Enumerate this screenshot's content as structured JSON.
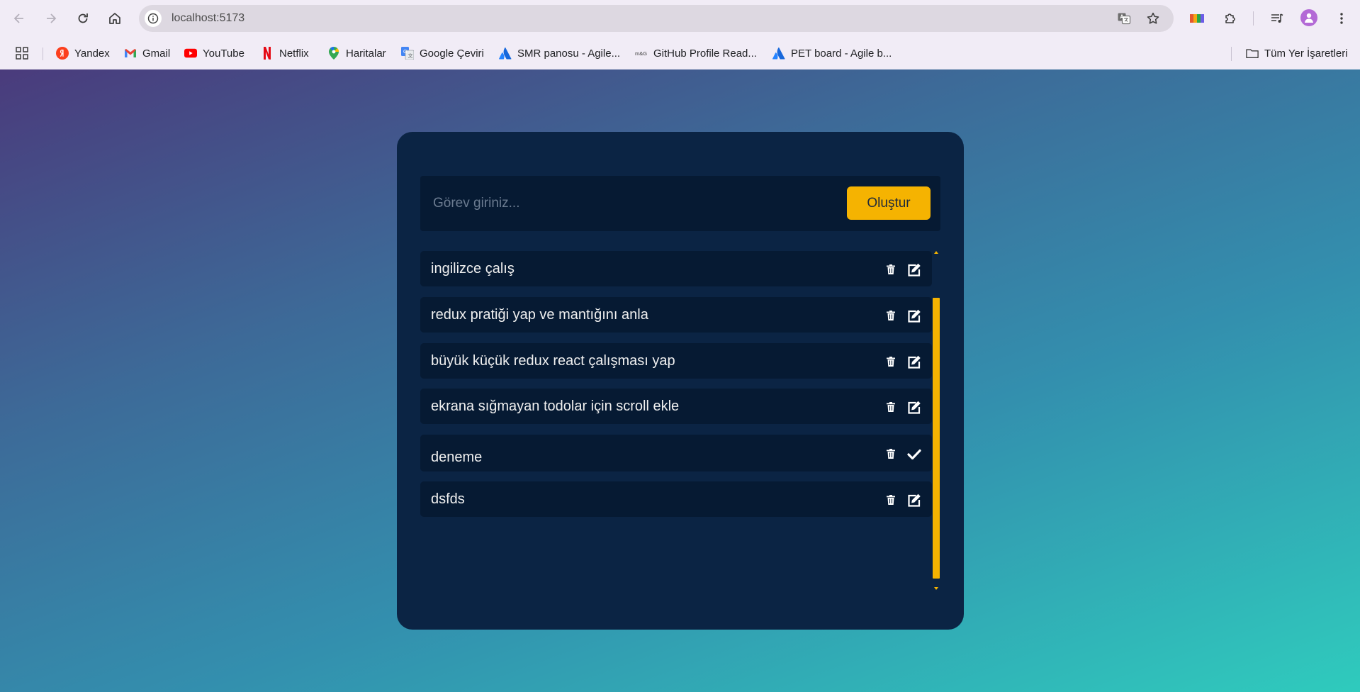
{
  "browser": {
    "url": "localhost:5173",
    "bookmarks": [
      {
        "label": "Yandex",
        "icon": "yandex-icon"
      },
      {
        "label": "Gmail",
        "icon": "gmail-icon"
      },
      {
        "label": "YouTube",
        "icon": "youtube-icon"
      },
      {
        "label": "Netflix",
        "icon": "netflix-icon"
      },
      {
        "label": "Haritalar",
        "icon": "maps-icon"
      },
      {
        "label": "Google Çeviri",
        "icon": "translate-icon"
      },
      {
        "label": "SMR panosu - Agile...",
        "icon": "atlassian-icon"
      },
      {
        "label": "GitHub Profile Read...",
        "icon": "github-readme-icon"
      },
      {
        "label": "PET board - Agile b...",
        "icon": "atlassian-icon"
      }
    ],
    "all_bookmarks_label": "Tüm Yer İşaretleri"
  },
  "app": {
    "input_placeholder": "Görev giriniz...",
    "input_value": "",
    "create_label": "Oluştur",
    "todos": [
      {
        "text": "ingilizce çalış",
        "editing": false
      },
      {
        "text": "redux pratiği yap ve mantığını anla",
        "editing": false
      },
      {
        "text": "büyük küçük redux react çalışması yap",
        "editing": false
      },
      {
        "text": "ekrana sığmayan todolar için scroll ekle",
        "editing": false
      },
      {
        "text": "deneme",
        "editing": true
      },
      {
        "text": "dsfds",
        "editing": false
      }
    ]
  },
  "colors": {
    "accent": "#f5b301",
    "card": "#0b2444",
    "row": "#061a33",
    "gradient_start": "#4a3b7c",
    "gradient_end": "#2fcbbd"
  }
}
